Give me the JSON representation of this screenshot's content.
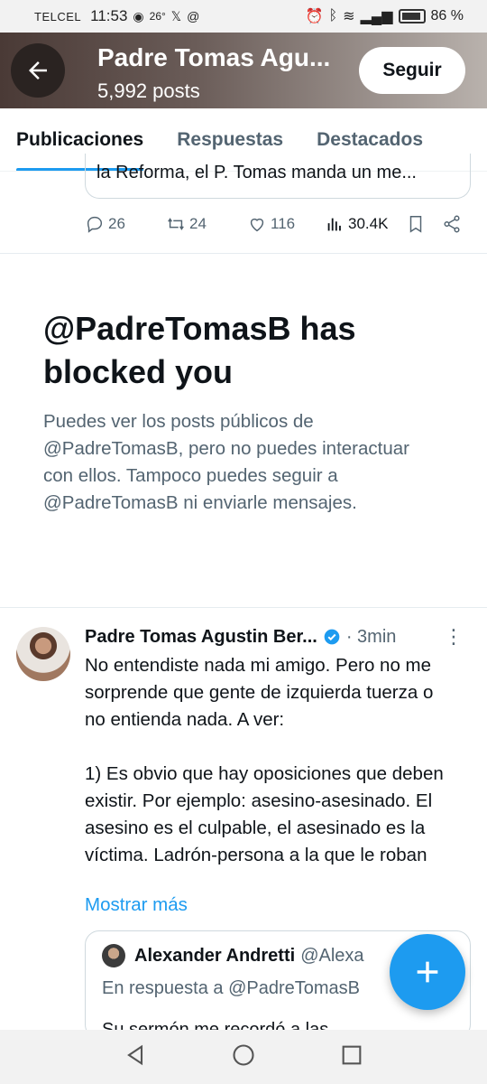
{
  "status_bar": {
    "carrier": "TELCEL",
    "time": "11:53",
    "temperature": "26°",
    "battery": "86 %"
  },
  "header": {
    "name": "Padre Tomas Agu...",
    "post_count": "5,992 posts",
    "follow_label": "Seguir"
  },
  "tabs": [
    {
      "label": "Publicaciones",
      "active": true
    },
    {
      "label": "Respuestas",
      "active": false
    },
    {
      "label": "Destacados",
      "active": false
    }
  ],
  "previous_post": {
    "quoted_text": "la Reforma, el P. Tomas manda un me...",
    "replies": "26",
    "reposts": "24",
    "likes": "116",
    "views": "30.4K"
  },
  "blocked_notice": {
    "title": "@PadreTomasB has blocked you",
    "description": "Puedes ver los posts públicos de @PadreTomasB, pero no puedes interactuar con ellos. Tampoco puedes seguir a @PadreTomasB ni enviarle mensajes."
  },
  "tweet": {
    "author": "Padre Tomas Agustin Ber...",
    "time": "· 3min",
    "paragraph_1": "No entendiste nada mi amigo. Pero no me sorprende que gente de izquierda tuerza o no entienda nada. A ver:",
    "paragraph_2": "1) Es obvio que hay oposiciones que deben existir. Por ejemplo: asesino-asesinado. El asesino es el culpable, el asesinado es la víctima. Ladrón-persona a la que le roban",
    "show_more": "Mostrar más",
    "quoted": {
      "author": "Alexander Andretti",
      "handle": "@Alexa",
      "reply_to": "En respuesta a @PadreTomasB",
      "text": "Su sermón me recordó a las"
    }
  },
  "colors": {
    "accent": "#1d9bf0",
    "secondary_text": "#536471",
    "primary_text": "#0f1419"
  }
}
